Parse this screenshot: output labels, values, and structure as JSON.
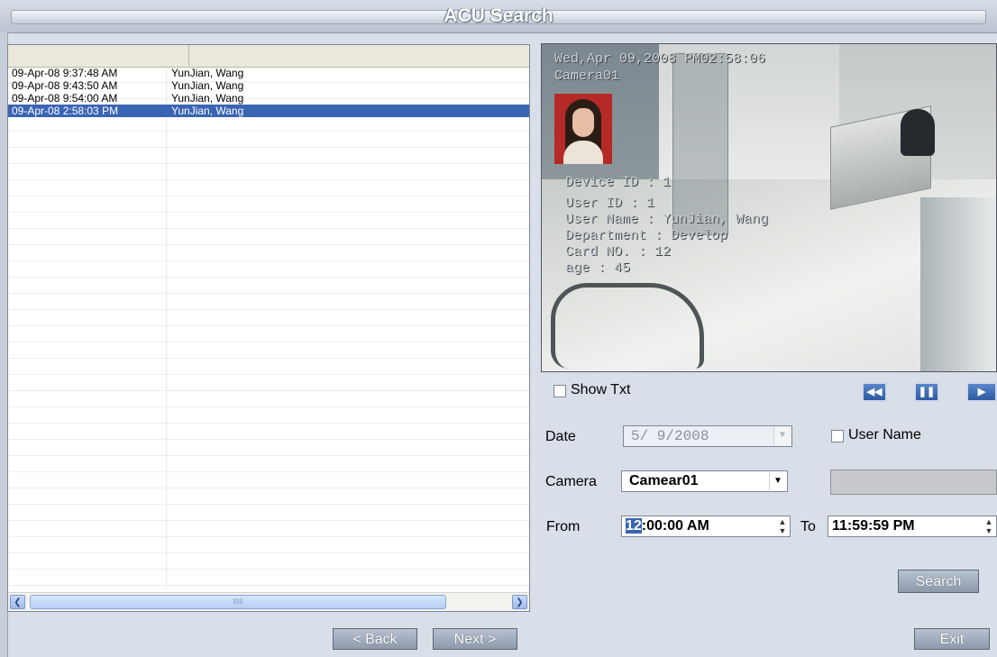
{
  "window": {
    "title": "ACU Search"
  },
  "list": {
    "rows": [
      {
        "time": "09-Apr-08 9:37:48 AM",
        "name": "YunJian, Wang"
      },
      {
        "time": "09-Apr-08 9:43:50 AM",
        "name": "YunJian, Wang"
      },
      {
        "time": "09-Apr-08 9:54:00 AM",
        "name": "YunJian, Wang"
      },
      {
        "time": "09-Apr-08 2:58:03 PM",
        "name": "YunJian, Wang"
      }
    ],
    "selected_index": 3,
    "scroll_thumb_grip": "IIIII"
  },
  "nav": {
    "back_label": "< Back",
    "next_label": "Next >"
  },
  "video": {
    "timestamp": "Wed,Apr 09,2008 PM02:58:06",
    "camera": "Camera01",
    "info": [
      "Device ID : 1",
      "User ID : 1",
      "User Name : YunJian, Wang",
      "Department : Develop",
      "Card NO. : 12",
      "age : 45"
    ]
  },
  "controls": {
    "show_txt_label": "Show Txt",
    "date_label": "Date",
    "date_value": "5/ 9/2008",
    "user_name_label": "User Name",
    "user_name_value": "",
    "camera_label": "Camera",
    "camera_value": "Camear01",
    "from_label": "From",
    "from_value_hour": "12",
    "from_value_rest": ":00:00 AM",
    "to_label": "To",
    "to_value": "11:59:59 PM",
    "search_label": "Search",
    "exit_label": "Exit"
  }
}
